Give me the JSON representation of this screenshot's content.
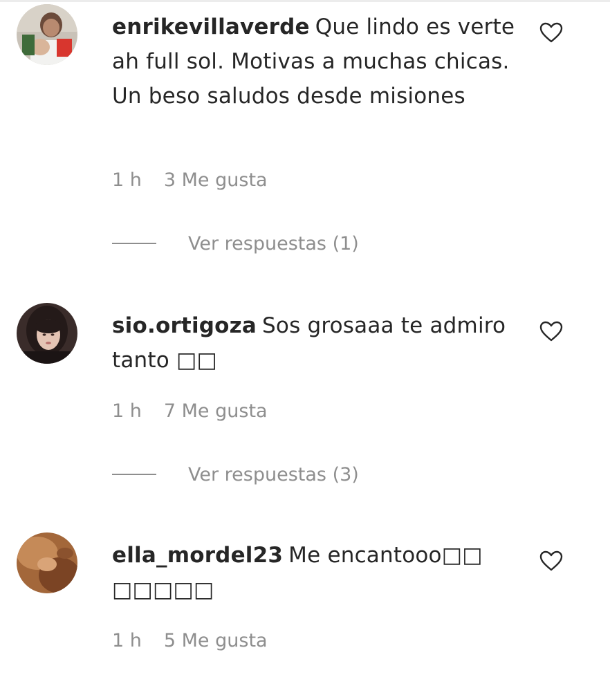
{
  "comments": [
    {
      "username": "enrikevillaverde",
      "text": "Que lindo es verte ah full sol. Motivas a muchas chicas. Un beso saludos desde misiones",
      "time": "1 h",
      "likes": "3 Me gusta",
      "replies": "Ver respuestas (1)",
      "avatar_icon": "profile-photo"
    },
    {
      "username": "sio.ortigoza",
      "text": "Sos grosaaa te admiro tanto □□",
      "time": "1 h",
      "likes": "7 Me gusta",
      "replies": "Ver respuestas (3)",
      "avatar_icon": "profile-photo"
    },
    {
      "username": "ella_mordel23",
      "text": "Me encantooo□□ □□□□□",
      "time": "1 h",
      "likes": "5 Me gusta",
      "avatar_icon": "profile-photo"
    }
  ],
  "like_icon": "heart-outline-icon",
  "colors": {
    "text": "#262626",
    "secondary_text": "#8e8e8e",
    "background": "#ffffff"
  }
}
